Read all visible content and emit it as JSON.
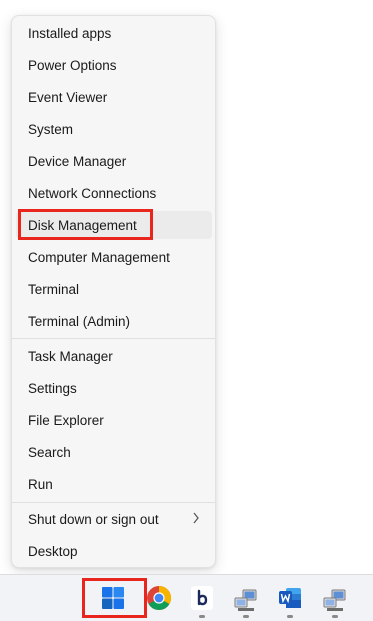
{
  "menu": {
    "items": [
      {
        "label": "Installed apps"
      },
      {
        "label": "Power Options"
      },
      {
        "label": "Event Viewer"
      },
      {
        "label": "System"
      },
      {
        "label": "Device Manager"
      },
      {
        "label": "Network Connections"
      },
      {
        "label": "Disk Management"
      },
      {
        "label": "Computer Management"
      },
      {
        "label": "Terminal"
      },
      {
        "label": "Terminal (Admin)"
      },
      {
        "label": "Task Manager"
      },
      {
        "label": "Settings"
      },
      {
        "label": "File Explorer"
      },
      {
        "label": "Search"
      },
      {
        "label": "Run"
      },
      {
        "label": "Shut down or sign out",
        "icon": "chevron-right-icon"
      },
      {
        "label": "Desktop"
      }
    ],
    "highlighted_item": "Disk Management"
  },
  "taskbar": {
    "icons": [
      {
        "name": "windows-start-icon"
      },
      {
        "name": "chrome-icon"
      },
      {
        "name": "app-b-icon"
      },
      {
        "name": "computer-network-icon"
      },
      {
        "name": "word-icon"
      },
      {
        "name": "computer-network-icon"
      }
    ]
  },
  "colors": {
    "highlight_border": "#e8261e",
    "menu_background": "#f6f6f6",
    "taskbar_background": "#f1f3f6",
    "windows_blue": "#1a73e8",
    "word_blue": "#185abd"
  }
}
